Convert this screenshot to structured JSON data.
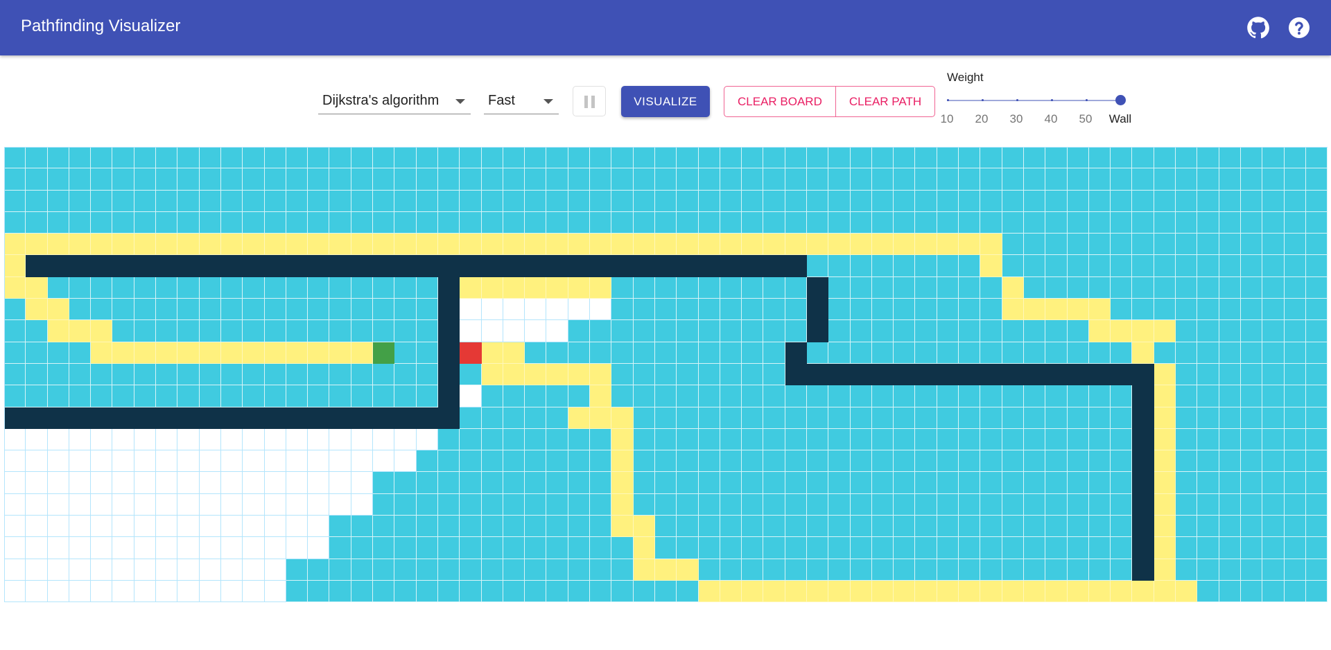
{
  "app": {
    "title": "Pathfinding Visualizer"
  },
  "header_icons": [
    {
      "name": "github-icon"
    },
    {
      "name": "help-icon"
    }
  ],
  "toolbar": {
    "algorithm_select": {
      "value": "Dijkstra's algorithm"
    },
    "speed_select": {
      "value": "Fast"
    },
    "pause_icon": "pause-icon",
    "visualize_label": "VISUALIZE",
    "clear_board_label": "CLEAR BOARD",
    "clear_path_label": "CLEAR PATH",
    "weight": {
      "label": "Weight",
      "ticks": [
        "10",
        "20",
        "30",
        "40",
        "50",
        "Wall"
      ],
      "selected": "Wall"
    }
  },
  "grid": {
    "rows": 21,
    "cols": 61,
    "legend": {
      "e": "unvisited",
      "v": "visited",
      "p": "path",
      "w": "wall",
      "s": "start",
      "t": "target"
    },
    "cells": [
      "vvvvvvvvvvvvvvvvvvvvvvvvvvvvvvvvvvvvvvvvvvvvvvvvvvvvvvvvvvvvv",
      "vvvvvvvvvvvvvvvvvvvvvvvvvvvvvvvvvvvvvvvvvvvvvvvvvvvvvvvvvvvvv",
      "vvvvvvvvvvvvvvvvvvvvvvvvvvvvvvvvvvvvvvvvvvvvvvvvvvvvvvvvvvvvv",
      "vvvvvvvvvvvvvvvvvvvvvvvvvvvvvvvvvvvvvvvvvvvvvvvvvvvvvvvvvvvvv",
      "ppppppppppppppppppppppppppppppppppppppppppppppvvvvvvvvvvvvvv",
      "pwwwwwwwwwwwwwwwwwwwwwwwwwwwwwwwwwwwwvvvvvvvvpvvvvvvvvvvvvvvv",
      "ppvvvvvvvvvvvvvvvvvvwpppppppvvvvvvvvvwvvvvvvvvpvvvvvvvvvvvvvvv",
      "vppvvvvvvvvvvvvvvvvvweeeeeeevvvvvvvvvwvvvvvvvvpppppvvvvvvvvvvv",
      "vvpppvvvvvvvvvvvvvvvweeeeevvvvvvvvvvvwvvvvvvvvvvvvppppvvvvvvvv",
      "vvvvpppppppppppppsvvwtppvvvvvvvvvvvvwvvvvvvvvvvvvvvvpvvvvvvvv",
      "vvvvvvvvvvvvvvvvvvvvwvppppppvvvvvvvvwwwwwwwwwwwwwwwwwpvvvvvvvv",
      "vvvvvvvvvvvvvvvvvvvvwevvvvvpvvvvvvvvvvvvvvvvvvvvvvvvwpvvvvvvvv",
      "wwwwwwwwwwwwwwwwwwwwwvvvvvpppvvvvvvvvvvvvvvvvvvvvvvvwpvvvvvvvv",
      "eeeeeeeeeeeeeeeeeeeevvvvvvvvpvvvvvvvvvvvvvvvvvvvvvvvwpvvvvvvvv",
      "eeeeeeeeeeeeeeeeeeevvvvvvvvvpvvvvvvvvvvvvvvvvvvvvvvvwpvvvvvvvv",
      "eeeeeeeeeeeeeeeeevvvvvvvvvvvpvvvvvvvvvvvvvvvvvvvvvvvwpvvvvvvvv",
      "eeeeeeeeeeeeeeeeevvvvvvvvvvvpvvvvvvvvvvvvvvvvvvvvvvvwpvvvvvvvv",
      "eeeeeeeeeeeeeeevvvvvvvvvvvvvppvvvvvvvvvvvvvvvvvvvvvvwpvvvvvvvv",
      "eeeeeeeeeeeeeeevvvvvvvvvvvvvvpvvvvvvvvvvvvvvvvvvvvvvwpvvvvvvvv",
      "eeeeeeeeeeeeevvvvvvvvvvvvvvvvpppvvvvvvvvvvvvvvvvvvvvwpvvvvvvvv",
      "eeeeeeeeeeeeevvvvvvvvvvvvvvvvvvvpppppppppppppppppppppppvvvvvvvv"
    ]
  }
}
